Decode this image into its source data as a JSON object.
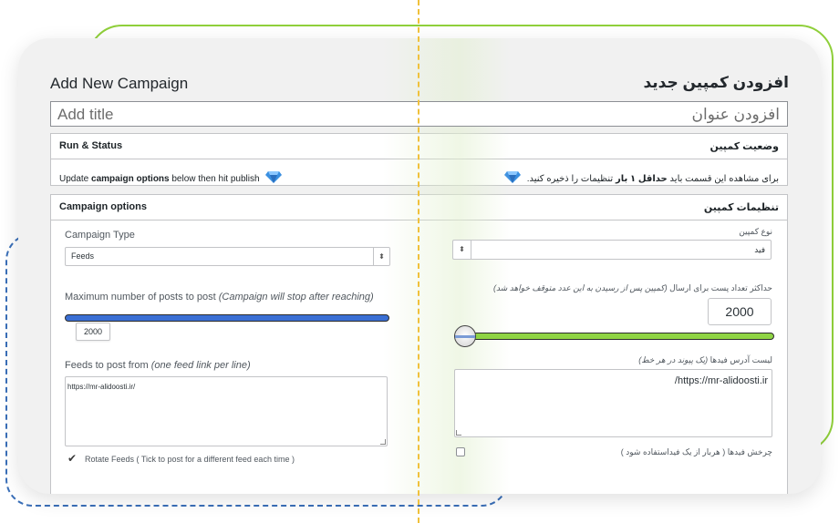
{
  "titles": {
    "en": "Add New Campaign",
    "fa": "افزودن کمپین جدید"
  },
  "title_input": {
    "placeholder_en": "Add title",
    "placeholder_fa": "افزودن عنوان"
  },
  "run_status": {
    "header_en": "Run & Status",
    "header_fa": "وضعیت کمپین",
    "text_en_before": "Update ",
    "text_en_bold": "campaign options",
    "text_en_after": " below then hit publish",
    "text_fa_before": "برای مشاهده این قسمت باید ",
    "text_fa_bold": "حداقل ۱ بار",
    "text_fa_after": " تنظیمات را ذخیره کنید."
  },
  "campaign_options": {
    "header_en": "Campaign options",
    "header_fa": "تنظیمات کمپین",
    "type_label_en": "Campaign Type",
    "type_value_en": "Feeds",
    "type_label_fa": "نوع کمپین",
    "type_value_fa": "فید",
    "max_label_en": "Maximum number of posts to post ",
    "max_note_en": "(Campaign will stop after reaching)",
    "max_value_en": "2000",
    "max_label_fa": "حداکثر تعداد پست برای ارسال ",
    "max_note_fa": "(کمپین پس از رسیدن به این عدد متوقف خواهد شد)",
    "max_value_fa": "2000",
    "feeds_label_en": "Feeds to post from ",
    "feeds_note_en": "(one feed link per line)",
    "feeds_value_en": "https://mr-alidoosti.ir/",
    "feeds_label_fa": "لیست آدرس فیدها ",
    "feeds_note_fa": "(یک پیوند در هر خط)",
    "feeds_value_fa": "https://mr-alidoosti.ir/",
    "rotate_label_en": "Rotate Feeds ( Tick to post for a different feed each time )",
    "rotate_checked_en": true,
    "rotate_label_fa": "چرخش فیدها ( هربار از یک فیداستفاده شود )",
    "rotate_checked_fa": false
  },
  "colors": {
    "en_slider": "#3a6fd4",
    "fa_slider": "#8fd444",
    "gem_icon": "#3a8fe0"
  },
  "icons": [
    "diamond-gem-icon",
    "select-arrows-icon",
    "check-icon",
    "resize-grip-icon"
  ]
}
